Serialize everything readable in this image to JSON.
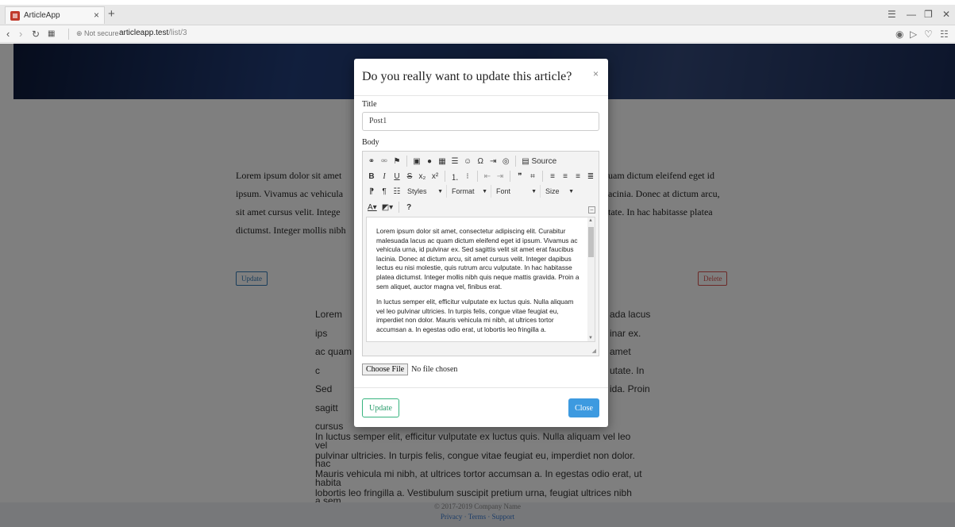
{
  "browser": {
    "tab_title": "ArticleApp",
    "tab_close": "×",
    "new_tab": "+",
    "security": "Not secure",
    "url_host": "articleapp.test",
    "url_path": "/list/3"
  },
  "page": {
    "paragraph_left": [
      "Lorem ipsum dolor sit amet",
      "ipsum. Vivamus ac vehicula",
      "sit amet cursus velit. Intege",
      "dictumst. Integer mollis nibh"
    ],
    "paragraph_right": [
      "uam dictum eleifend eget id",
      "acinia. Donec at dictum arcu,",
      "tate. In hac habitasse platea"
    ],
    "update_label": "Update",
    "delete_label": "Delete",
    "body_left": [
      "Lorem ips",
      "ac quam c",
      "Sed sagitt",
      "cursus vel",
      "hac habita",
      "a sem aliq"
    ],
    "body_right": [
      "ada lacus",
      "inar ex.",
      "amet",
      "utate. In",
      "ida. Proin"
    ],
    "body_full": [
      "In luctus semper elit, efficitur vulputate ex luctus quis. Nulla aliquam vel leo",
      "pulvinar ultricies. In turpis felis, congue vitae feugiat eu, imperdiet non dolor.",
      "Mauris vehicula mi nibh, at ultrices tortor accumsan a. In egestas odio erat, ut",
      "lobortis leo fringilla a. Vestibulum suscipit pretium urna, feugiat ultrices nibh"
    ],
    "footer_copyright": "© 2017-2019 Company Name",
    "footer_links": "Privacy · Terms · Support"
  },
  "modal": {
    "title": "Do you really want to update this article?",
    "close_x": "×",
    "title_label": "Title",
    "title_value": "Post1",
    "body_label": "Body",
    "toolbar": {
      "source": "Source",
      "styles": "Styles",
      "format": "Format",
      "font": "Font",
      "size": "Size",
      "help": "?"
    },
    "editor_paragraphs": [
      "Lorem ipsum dolor sit amet, consectetur adipiscing elit. Curabitur malesuada lacus ac quam dictum eleifend eget id ipsum. Vivamus ac vehicula urna, id pulvinar ex. Sed sagittis velit sit amet erat faucibus lacinia. Donec at dictum arcu, sit amet cursus velit. Integer dapibus lectus eu nisi molestie, quis rutrum arcu vulputate. In hac habitasse platea dictumst. Integer mollis nibh quis neque mattis gravida. Proin a sem aliquet, auctor magna vel, finibus erat.",
      "In luctus semper elit, efficitur vulputate ex luctus quis. Nulla aliquam vel leo pulvinar ultricies. In turpis felis, congue vitae feugiat eu, imperdiet non dolor. Mauris vehicula mi nibh, at ultrices tortor accumsan a. In egestas odio erat, ut lobortis leo fringilla a."
    ],
    "choose_file": "Choose File",
    "no_file": "No file chosen",
    "update_button": "Update",
    "close_button": "Close"
  },
  "colors": {
    "update_green": "#36b37e",
    "close_blue": "#3d9ae0",
    "delete_red": "#d9534f"
  }
}
